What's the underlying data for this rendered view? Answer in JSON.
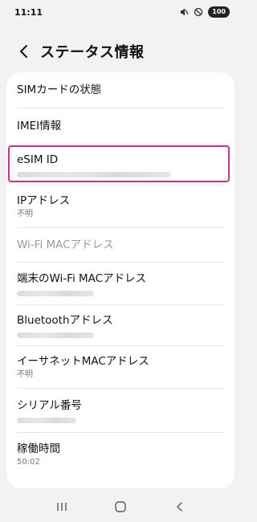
{
  "status_bar": {
    "time": "11:11",
    "battery": "100",
    "icons": [
      "mute-icon",
      "do-not-disturb-icon",
      "battery-icon"
    ]
  },
  "header": {
    "back_icon": "chevron-left-icon",
    "title": "ステータス情報"
  },
  "rows": [
    {
      "label": "SIMカードの状態"
    },
    {
      "label": "IMEI情報"
    },
    {
      "label": "eSIM ID",
      "value_hidden": true
    },
    {
      "label": "IPアドレス",
      "value": "不明"
    },
    {
      "label": "Wi-Fi MACアドレス",
      "disabled": true
    },
    {
      "label": "端末のWi-Fi MACアドレス",
      "value_hidden": true
    },
    {
      "label": "Bluetoothアドレス",
      "value_hidden": true
    },
    {
      "label": "イーサネットMACアドレス",
      "value": "不明"
    },
    {
      "label": "シリアル番号",
      "value_hidden": true
    },
    {
      "label": "稼働時間",
      "value": "50:02"
    }
  ],
  "colors": {
    "highlight": "#e0298a",
    "background": "#f2f2f2",
    "card": "#ffffff"
  },
  "nav_bar": {
    "icons": [
      "recent-apps-icon",
      "home-icon",
      "back-icon"
    ]
  }
}
